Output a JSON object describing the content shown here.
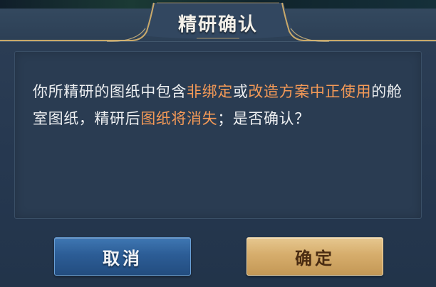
{
  "dialog": {
    "title": "精研确认",
    "message": {
      "part1": "你所精研的图纸中包含",
      "highlight1": "非绑定",
      "part2": "或",
      "highlight2": "改造方案中正使用",
      "part3": "的舱室图纸，精研后",
      "highlight3": "图纸将消失",
      "part4": "；是否确认？"
    },
    "buttons": {
      "cancel_label": "取消",
      "confirm_label": "确定"
    },
    "colors": {
      "highlight": "#f59a57",
      "cancel_button": "#2c5d96",
      "confirm_button": "#d6ad6c",
      "gold_trim": "#c9a96a"
    }
  }
}
